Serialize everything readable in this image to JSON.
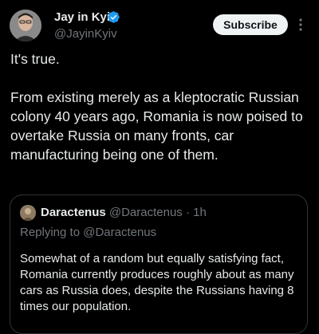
{
  "post": {
    "author": {
      "name": "Jay in Kyiv",
      "handle": "@JayinKyiv",
      "verified_color": "#1d9bf0"
    },
    "subscribe_label": "Subscribe",
    "more_icon": "vertical-ellipsis",
    "text_paragraphs": [
      "It's true.",
      "From existing merely as a kleptocratic Russian colony 40 years ago, Romania is now poised to overtake Russia on many fronts, car manufacturing being one of them."
    ]
  },
  "quoted_post": {
    "author": {
      "name": "Daractenus",
      "handle": "@Daractenus"
    },
    "separator": "·",
    "time": "1h",
    "replying_to": "Replying to @Daractenus",
    "text": "Somewhat of a random but equally satisfying fact, Romania currently produces roughly about as many cars as Russia does, despite the Russians having 8 times our population."
  },
  "colors": {
    "background": "#000000",
    "text_primary": "#e7e9ea",
    "text_secondary": "#71767b",
    "border": "#2f3336",
    "button_bg": "#eff3f4",
    "accent": "#1d9bf0"
  }
}
